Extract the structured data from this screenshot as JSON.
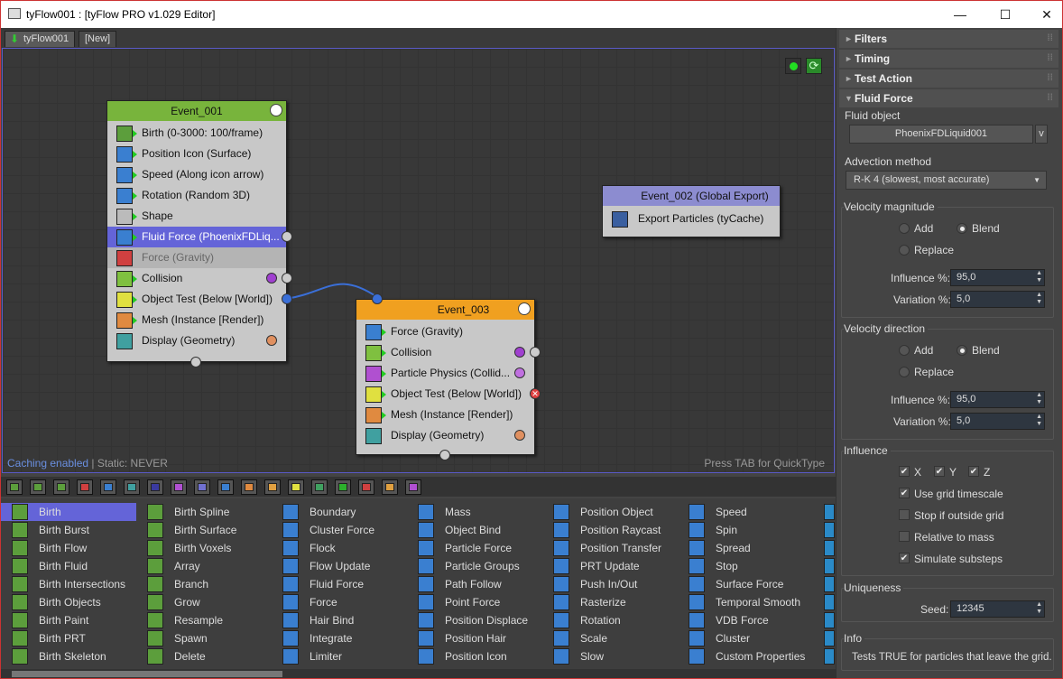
{
  "window": {
    "title": "tyFlow001 : [tyFlow PRO v1.029 Editor]",
    "minimize": "—",
    "maximize": "☐",
    "close": "✕"
  },
  "tabs": [
    {
      "label": "tyFlow001"
    },
    {
      "label": "[New]"
    }
  ],
  "canvas": {
    "caching_status": "Caching enabled",
    "static_status": "| Static: NEVER",
    "hint": "Press TAB for QuickType"
  },
  "events": {
    "e1": {
      "title": "Event_001",
      "color": "#78b43c",
      "ops": [
        {
          "label": "Birth (0-3000: 100/frame)",
          "color": "#5c9e3c"
        },
        {
          "label": "Position Icon (Surface)",
          "color": "#3a7fd0"
        },
        {
          "label": "Speed (Along icon arrow)",
          "color": "#3a7fd0"
        },
        {
          "label": "Rotation (Random 3D)",
          "color": "#3a7fd0"
        },
        {
          "label": "Shape",
          "color": "#bbbbbb"
        },
        {
          "label": "Fluid Force (PhoenixFDLiq...",
          "color": "#3a7fd0"
        },
        {
          "label": "Force (Gravity)",
          "color": "#d04040"
        },
        {
          "label": "Collision",
          "color": "#7fc040"
        },
        {
          "label": "Object Test (Below [World])",
          "color": "#e0e040"
        },
        {
          "label": "Mesh (Instance [Render])",
          "color": "#e08a40"
        },
        {
          "label": "Display (Geometry)",
          "color": "#40a0a0"
        }
      ]
    },
    "e2": {
      "title": "Event_002 (Global Export)",
      "color": "#8c8cd0",
      "ops": [
        {
          "label": "Export Particles (tyCache)",
          "color": "#3a5fa0"
        }
      ]
    },
    "e3": {
      "title": "Event_003",
      "color": "#f0a020",
      "ops": [
        {
          "label": "Force (Gravity)",
          "color": "#3a7fd0"
        },
        {
          "label": "Collision",
          "color": "#7fc040"
        },
        {
          "label": "Particle Physics (Collid...",
          "color": "#b050d0"
        },
        {
          "label": "Object Test (Below [World])",
          "color": "#e0e040"
        },
        {
          "label": "Mesh (Instance [Render])",
          "color": "#e08a40"
        },
        {
          "label": "Display (Geometry)",
          "color": "#40a0a0"
        }
      ]
    }
  },
  "palette": {
    "columns": [
      [
        "Birth",
        "Birth Burst",
        "Birth Flow",
        "Birth Fluid",
        "Birth Intersections",
        "Birth Objects",
        "Birth Paint",
        "Birth PRT",
        "Birth Skeleton"
      ],
      [
        "Birth Spline",
        "Birth Surface",
        "Birth Voxels",
        "Array",
        "Branch",
        "Grow",
        "Resample",
        "Spawn",
        "Delete"
      ],
      [
        "Boundary",
        "Cluster Force",
        "Flock",
        "Flow Update",
        "Fluid Force",
        "Force",
        "Hair Bind",
        "Integrate",
        "Limiter"
      ],
      [
        "Mass",
        "Object Bind",
        "Particle Force",
        "Particle Groups",
        "Path Follow",
        "Point Force",
        "Position Displace",
        "Position Hair",
        "Position Icon"
      ],
      [
        "Position Object",
        "Position Raycast",
        "Position Transfer",
        "PRT Update",
        "Push In/Out",
        "Rasterize",
        "Rotation",
        "Scale",
        "Slow"
      ],
      [
        "Speed",
        "Spin",
        "Spread",
        "Stop",
        "Surface Force",
        "Temporal Smooth",
        "VDB Force",
        "Cluster",
        "Custom Properties"
      ]
    ],
    "colors": [
      "#5c9e3c",
      "#5c9e3c",
      "#3a7fd0",
      "#3a7fd0",
      "#3a7fd0",
      "#3a7fd0"
    ]
  },
  "right": {
    "sections": {
      "filters": "Filters",
      "timing": "Timing",
      "test_action": "Test Action",
      "fluid_force": "Fluid Force"
    },
    "fluid_object_label": "Fluid object",
    "fluid_object_value": "PhoenixFDLiquid001",
    "fluid_object_v": "v",
    "advection_label": "Advection method",
    "advection_value": "R-K 4 (slowest, most accurate)",
    "vel_mag": {
      "label": "Velocity magnitude",
      "add": "Add",
      "blend": "Blend",
      "replace": "Replace",
      "influence_label": "Influence %:",
      "influence": "95,0",
      "variation_label": "Variation %:",
      "variation": "5,0"
    },
    "vel_dir": {
      "label": "Velocity direction",
      "add": "Add",
      "blend": "Blend",
      "replace": "Replace",
      "influence_label": "Influence %:",
      "influence": "95,0",
      "variation_label": "Variation %:",
      "variation": "5,0"
    },
    "influence": {
      "label": "Influence",
      "x": "X",
      "y": "Y",
      "z": "Z",
      "grid_timescale": "Use grid timescale",
      "stop_outside": "Stop if outside grid",
      "relative_mass": "Relative to mass",
      "simulate_substeps": "Simulate substeps"
    },
    "uniqueness": {
      "label": "Uniqueness",
      "seed_label": "Seed:",
      "seed": "12345"
    },
    "info": {
      "label": "Info",
      "text": "Tests TRUE for particles that leave the grid."
    }
  }
}
